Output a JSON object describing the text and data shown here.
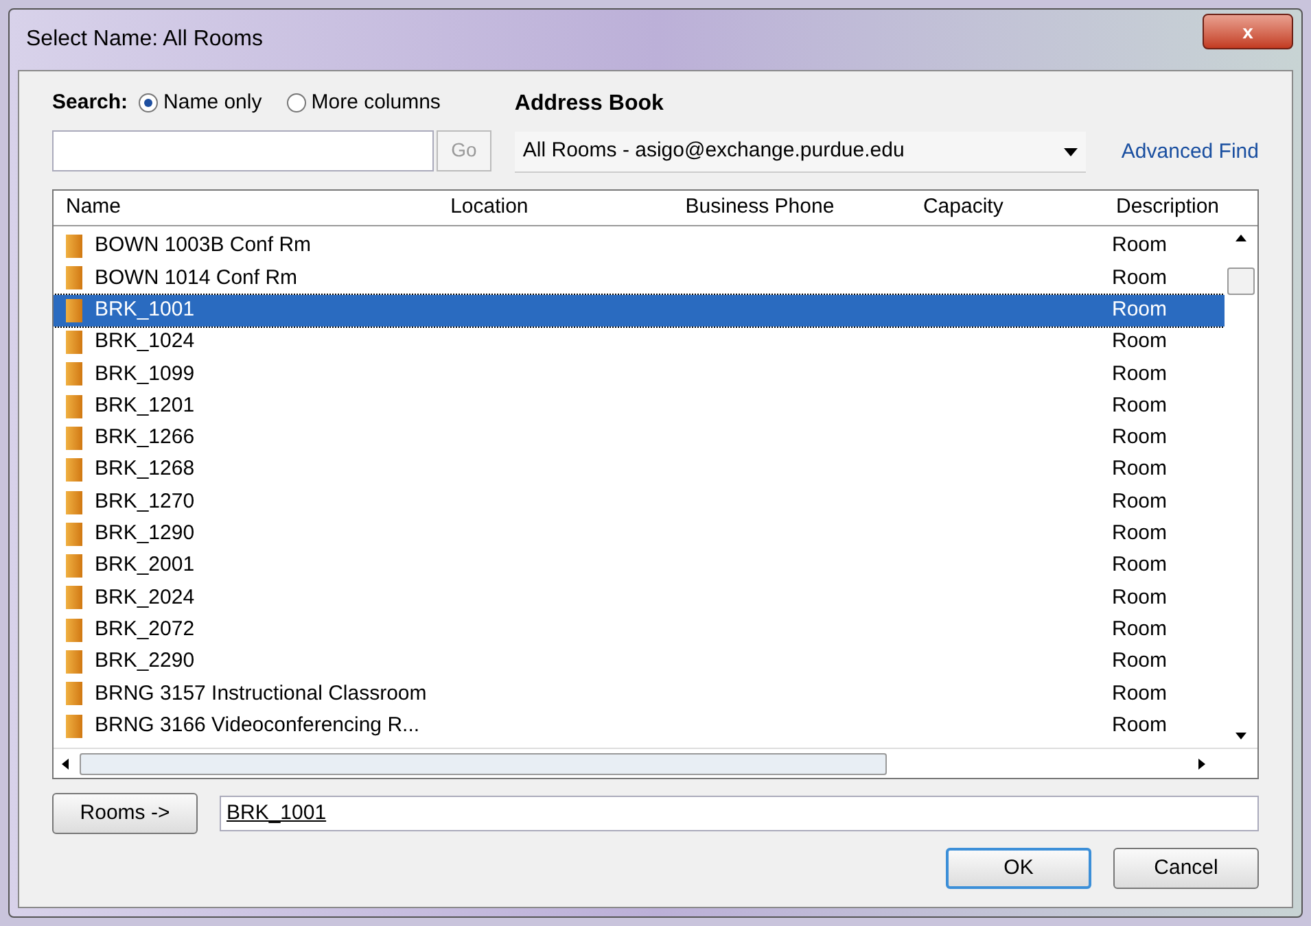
{
  "window": {
    "title": "Select Name: All Rooms",
    "close": "x"
  },
  "search": {
    "label": "Search:",
    "options": [
      {
        "label": "Name only",
        "selected": true
      },
      {
        "label": "More columns",
        "selected": false
      }
    ],
    "go": "Go"
  },
  "address_book": {
    "label": "Address Book",
    "value": "All Rooms - asigo@exchange.purdue.edu",
    "advanced_find": "Advanced Find"
  },
  "table": {
    "columns": [
      "Name",
      "Location",
      "Business Phone",
      "Capacity",
      "Description"
    ],
    "rows": [
      {
        "name": "BOWN 1003B Conf Rm",
        "description": "Room",
        "selected": false
      },
      {
        "name": "BOWN 1014 Conf Rm",
        "description": "Room",
        "selected": false
      },
      {
        "name": "BRK_1001",
        "description": "Room",
        "selected": true
      },
      {
        "name": "BRK_1024",
        "description": "Room",
        "selected": false
      },
      {
        "name": "BRK_1099",
        "description": "Room",
        "selected": false
      },
      {
        "name": "BRK_1201",
        "description": "Room",
        "selected": false
      },
      {
        "name": "BRK_1266",
        "description": "Room",
        "selected": false
      },
      {
        "name": "BRK_1268",
        "description": "Room",
        "selected": false
      },
      {
        "name": "BRK_1270",
        "description": "Room",
        "selected": false
      },
      {
        "name": "BRK_1290",
        "description": "Room",
        "selected": false
      },
      {
        "name": "BRK_2001",
        "description": "Room",
        "selected": false
      },
      {
        "name": "BRK_2024",
        "description": "Room",
        "selected": false
      },
      {
        "name": "BRK_2072",
        "description": "Room",
        "selected": false
      },
      {
        "name": "BRK_2290",
        "description": "Room",
        "selected": false
      },
      {
        "name": "BRNG 3157 Instructional Classroom",
        "description": "Room",
        "selected": false
      },
      {
        "name": "BRNG 3166 Videoconferencing R...",
        "description": "Room",
        "selected": false
      }
    ]
  },
  "rooms": {
    "button": "Rooms ->",
    "value": "BRK_1001"
  },
  "buttons": [
    "OK",
    "Cancel"
  ]
}
